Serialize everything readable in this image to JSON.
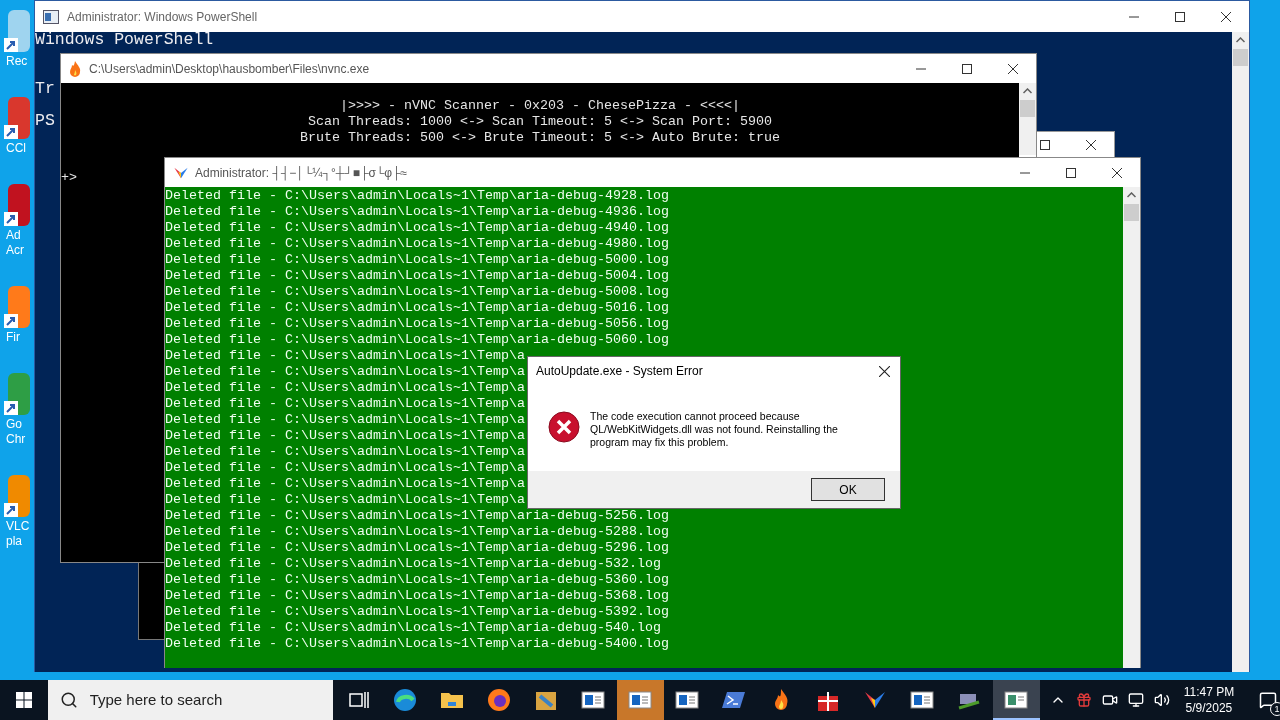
{
  "desktop_icons": [
    {
      "kind": "recycle",
      "lines": [
        "Rec"
      ]
    },
    {
      "kind": "ccleaner",
      "lines": [
        "CCl"
      ]
    },
    {
      "kind": "acrobat",
      "lines": [
        "Ad",
        "Acr"
      ]
    },
    {
      "kind": "firefox",
      "lines": [
        "Fir"
      ]
    },
    {
      "kind": "chrome",
      "lines": [
        "Go",
        "Chr"
      ]
    },
    {
      "kind": "vlc",
      "lines": [
        "VLC",
        "pla"
      ]
    }
  ],
  "powershell": {
    "title": "Administrator: Windows PowerShell",
    "lines": [
      "Windows PowerShell",
      "Tr",
      "PS"
    ]
  },
  "nvnc": {
    "title": "C:\\Users\\admin\\Desktop\\hausbomber\\Files\\nvnc.exe",
    "banner": [
      "|>>>> - nVNC Scanner - 0x203 - CheesePizza - <<<<|",
      "Scan Threads: 1000 <-> Scan Timeout: 5 <-> Scan Port: 5900",
      "Brute Threads: 500 <-> Brute Timeout: 5 <-> Auto Brute: true"
    ],
    "prompt": "+>"
  },
  "console": {
    "title": "Administrator: ┤┤−│└¼┐°┼┘■├σ└φ├≈",
    "lines": [
      "Deleted file - C:\\Users\\admin\\Locals~1\\Temp\\aria-debug-4928.log",
      "Deleted file - C:\\Users\\admin\\Locals~1\\Temp\\aria-debug-4936.log",
      "Deleted file - C:\\Users\\admin\\Locals~1\\Temp\\aria-debug-4940.log",
      "Deleted file - C:\\Users\\admin\\Locals~1\\Temp\\aria-debug-4980.log",
      "Deleted file - C:\\Users\\admin\\Locals~1\\Temp\\aria-debug-5000.log",
      "Deleted file - C:\\Users\\admin\\Locals~1\\Temp\\aria-debug-5004.log",
      "Deleted file - C:\\Users\\admin\\Locals~1\\Temp\\aria-debug-5008.log",
      "Deleted file - C:\\Users\\admin\\Locals~1\\Temp\\aria-debug-5016.log",
      "Deleted file - C:\\Users\\admin\\Locals~1\\Temp\\aria-debug-5056.log",
      "Deleted file - C:\\Users\\admin\\Locals~1\\Temp\\aria-debug-5060.log",
      "Deleted file - C:\\Users\\admin\\Locals~1\\Temp\\a",
      "Deleted file - C:\\Users\\admin\\Locals~1\\Temp\\a",
      "Deleted file - C:\\Users\\admin\\Locals~1\\Temp\\a",
      "Deleted file - C:\\Users\\admin\\Locals~1\\Temp\\a",
      "Deleted file - C:\\Users\\admin\\Locals~1\\Temp\\a",
      "Deleted file - C:\\Users\\admin\\Locals~1\\Temp\\a",
      "Deleted file - C:\\Users\\admin\\Locals~1\\Temp\\a",
      "Deleted file - C:\\Users\\admin\\Locals~1\\Temp\\a",
      "Deleted file - C:\\Users\\admin\\Locals~1\\Temp\\a",
      "Deleted file - C:\\Users\\admin\\Locals~1\\Temp\\a",
      "Deleted file - C:\\Users\\admin\\Locals~1\\Temp\\aria-debug-5256.log",
      "Deleted file - C:\\Users\\admin\\Locals~1\\Temp\\aria-debug-5288.log",
      "Deleted file - C:\\Users\\admin\\Locals~1\\Temp\\aria-debug-5296.log",
      "Deleted file - C:\\Users\\admin\\Locals~1\\Temp\\aria-debug-532.log",
      "Deleted file - C:\\Users\\admin\\Locals~1\\Temp\\aria-debug-5360.log",
      "Deleted file - C:\\Users\\admin\\Locals~1\\Temp\\aria-debug-5368.log",
      "Deleted file - C:\\Users\\admin\\Locals~1\\Temp\\aria-debug-5392.log",
      "Deleted file - C:\\Users\\admin\\Locals~1\\Temp\\aria-debug-540.log",
      "Deleted file - C:\\Users\\admin\\Locals~1\\Temp\\aria-debug-5400.log"
    ]
  },
  "dialog": {
    "title": "AutoUpdate.exe - System Error",
    "message": "The code execution cannot proceed because QL/WebKitWidgets.dll was not found. Reinstalling the program may fix this problem.",
    "button": "OK"
  },
  "taskbar": {
    "search_placeholder": "Type here to search",
    "apps": [
      {
        "kind": "taskview",
        "selected": false,
        "flashing": false
      },
      {
        "kind": "edge",
        "selected": false,
        "flashing": false
      },
      {
        "kind": "folder",
        "selected": false,
        "flashing": false
      },
      {
        "kind": "firefox",
        "selected": false,
        "flashing": false
      },
      {
        "kind": "package",
        "selected": false,
        "flashing": false
      },
      {
        "kind": "window",
        "selected": false,
        "flashing": false
      },
      {
        "kind": "window",
        "selected": false,
        "flashing": true
      },
      {
        "kind": "window",
        "selected": false,
        "flashing": false
      },
      {
        "kind": "powershell",
        "selected": false,
        "flashing": false
      },
      {
        "kind": "flame",
        "selected": false,
        "flashing": false
      },
      {
        "kind": "gift",
        "selected": false,
        "flashing": false
      },
      {
        "kind": "butterfly",
        "selected": false,
        "flashing": false
      },
      {
        "kind": "window",
        "selected": false,
        "flashing": false
      },
      {
        "kind": "tool",
        "selected": false,
        "flashing": false
      },
      {
        "kind": "console",
        "selected": true,
        "flashing": false
      }
    ],
    "time": "11:47 PM",
    "date": "5/9/2025",
    "notifications": "1"
  }
}
